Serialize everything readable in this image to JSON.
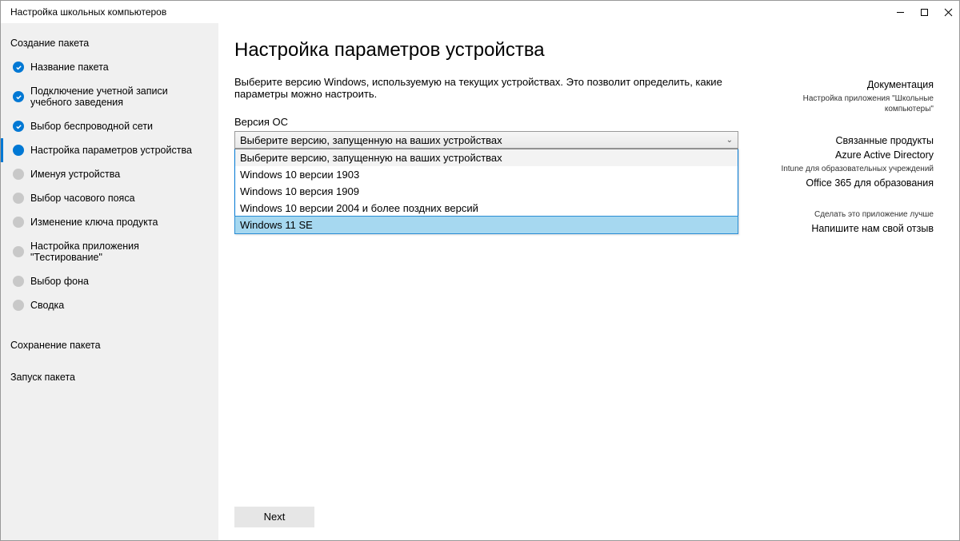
{
  "window": {
    "title": "Настройка школьных компьютеров"
  },
  "sidebar": {
    "section_create": "Создание пакета",
    "steps": [
      {
        "label": "Название пакета",
        "state": "done"
      },
      {
        "label": "Подключение учетной записи учебного заведения",
        "state": "done"
      },
      {
        "label": "Выбор беспроводной сети",
        "state": "done"
      },
      {
        "label": "Настройка параметров устройства",
        "state": "current"
      },
      {
        "label": "Именуя устройства",
        "state": "pending"
      },
      {
        "label": "Выбор часового пояса",
        "state": "pending"
      },
      {
        "label": "Изменение ключа продукта",
        "state": "pending"
      },
      {
        "label": "Настройка приложения \"Тестирование\"",
        "state": "pending"
      },
      {
        "label": "Выбор фона",
        "state": "pending"
      },
      {
        "label": "Сводка",
        "state": "pending"
      }
    ],
    "section_save": "Сохранение пакета",
    "section_run": "Запуск пакета"
  },
  "main": {
    "title": "Настройка параметров устройства",
    "description": "Выберите версию Windows, используемую на текущих устройствах. Это позволит определить, какие параметры можно настроить.",
    "os_label": "Версия ОС",
    "select_placeholder": "Выберите версию, запущенную на ваших устройствах",
    "options": [
      "Выберите версию, запущенную на ваших устройствах",
      "Windows 10 версии 1903",
      "Windows 10 версия 1909",
      "Windows 10 версии 2004 и более поздних версий",
      "Windows 11  SE"
    ],
    "highlighted_index": 4,
    "next_button": "Next"
  },
  "rightpane": {
    "doc_title": "Документация",
    "doc_sub": "Настройка приложения \"Школьные компьютеры\"",
    "related_title": "Связанные продукты",
    "related_items": [
      "Azure Active Directory",
      "Intune для образовательных учреждений",
      "Office 365 для образования"
    ],
    "feedback_title": "Сделать это приложение лучше",
    "feedback_link": "Напишите нам свой отзыв"
  }
}
